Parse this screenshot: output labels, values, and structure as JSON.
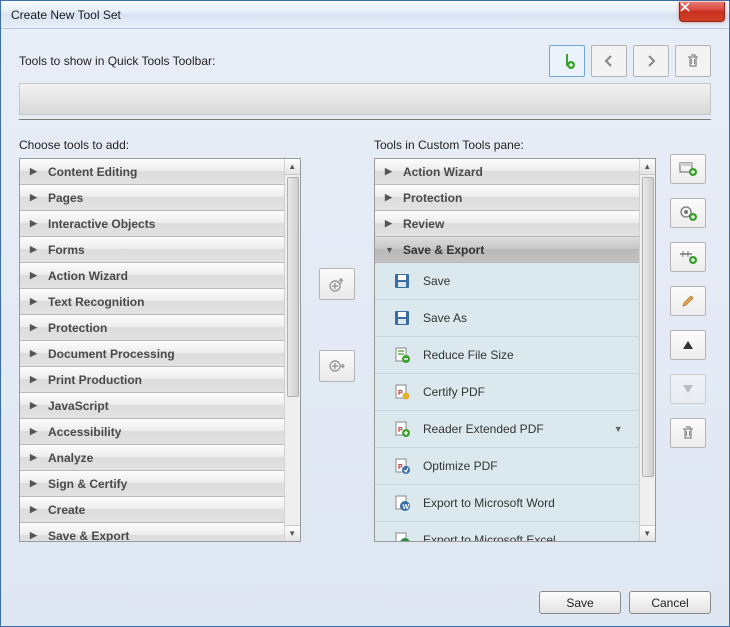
{
  "window": {
    "title": "Create New Tool Set"
  },
  "top": {
    "label": "Tools to show in Quick Tools Toolbar:"
  },
  "topButtons": {
    "addDivider": "add-divider",
    "prev": "prev",
    "next": "next",
    "delete": "delete"
  },
  "left": {
    "label": "Choose tools to add:",
    "categories": [
      "Content Editing",
      "Pages",
      "Interactive Objects",
      "Forms",
      "Action Wizard",
      "Text Recognition",
      "Protection",
      "Document Processing",
      "Print Production",
      "JavaScript",
      "Accessibility",
      "Analyze",
      "Sign & Certify",
      "Create",
      "Save & Export"
    ]
  },
  "right": {
    "label": "Tools in Custom Tools pane:",
    "categories": [
      {
        "name": "Action Wizard",
        "expanded": false
      },
      {
        "name": "Protection",
        "expanded": false
      },
      {
        "name": "Review",
        "expanded": false
      },
      {
        "name": "Save & Export",
        "expanded": true
      }
    ],
    "items": [
      {
        "label": "Save",
        "icon": "save"
      },
      {
        "label": "Save As",
        "icon": "save"
      },
      {
        "label": "Reduce File Size",
        "icon": "compress"
      },
      {
        "label": "Certify PDF",
        "icon": "certify"
      },
      {
        "label": "Reader Extended PDF",
        "icon": "reader",
        "submenu": true
      },
      {
        "label": "Optimize PDF",
        "icon": "optimize"
      },
      {
        "label": "Export to Microsoft Word",
        "icon": "word"
      },
      {
        "label": "Export to Microsoft Excel",
        "icon": "excel"
      }
    ]
  },
  "midButtons": {
    "moveUp": "move-to-toolbar",
    "moveRight": "add-to-custom"
  },
  "sideButtons": {
    "addPanel": "add-panel",
    "addTool": "add-tool",
    "addDivider": "add-divider",
    "edit": "edit",
    "moveUpList": "move-up",
    "moveDownList": "move-down",
    "deleteItem": "delete"
  },
  "footer": {
    "save": "Save",
    "cancel": "Cancel"
  },
  "colors": {
    "titlebar": "#e4ecf7",
    "close": "#d9453a",
    "itemBg": "#dbe9ef",
    "green": "#3da02e",
    "orange": "#e07a2a",
    "blue": "#3a6ea5"
  }
}
